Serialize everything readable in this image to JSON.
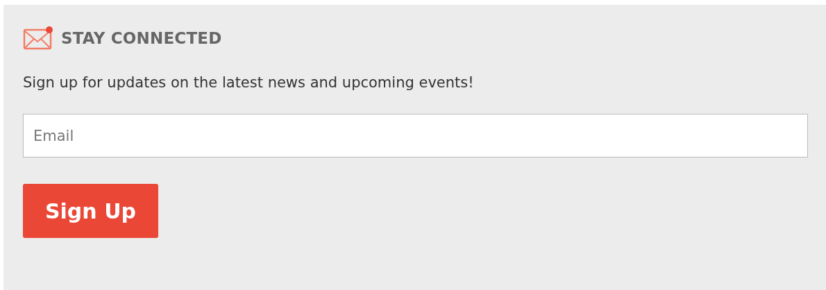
{
  "heading": "STAY CONNECTED",
  "description": "Sign up for updates on the latest news and upcoming events!",
  "email_field": {
    "placeholder": "Email"
  },
  "submit_button": "Sign Up"
}
